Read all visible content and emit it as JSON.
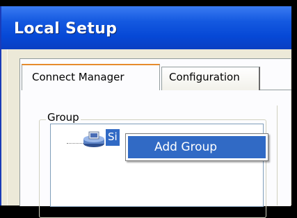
{
  "window": {
    "title": "Local Setup"
  },
  "tabs": [
    {
      "label": "Connect Manager",
      "active": true
    },
    {
      "label": "Configuration",
      "active": false
    }
  ],
  "group": {
    "label": "Group",
    "tree_node": {
      "label": "Si",
      "icon": "server-group-icon"
    }
  },
  "context_menu": {
    "items": [
      {
        "label": "Add Group"
      }
    ]
  },
  "colors": {
    "titlebar": "#0648d6",
    "selection": "#316ac5",
    "tab_hot": "#e68b2c"
  }
}
